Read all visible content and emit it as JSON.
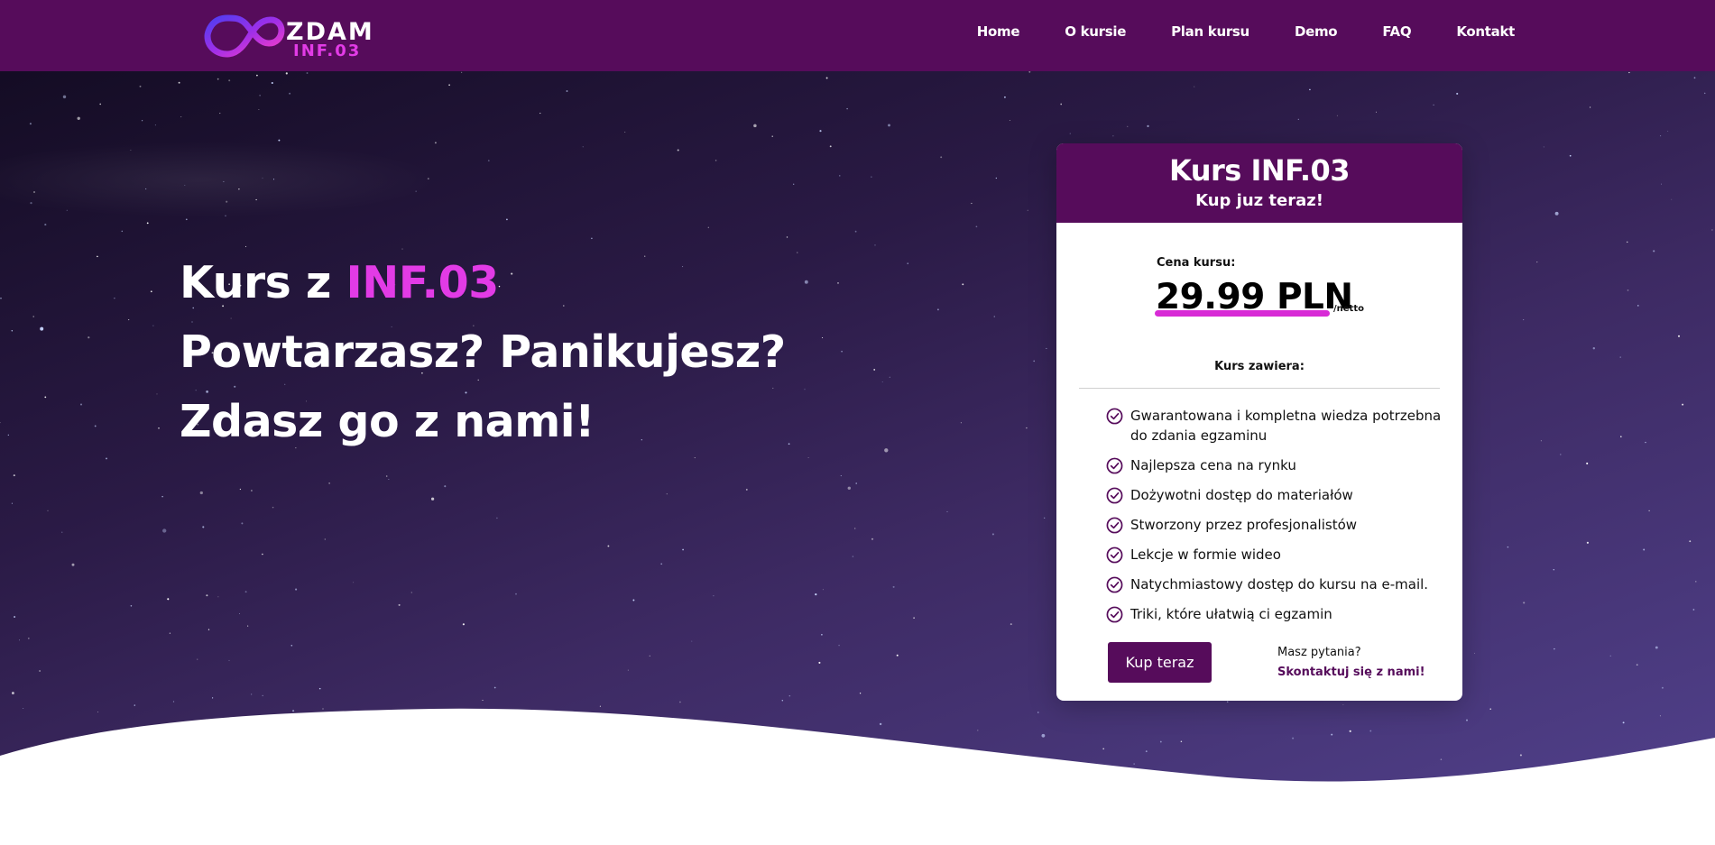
{
  "header": {
    "logo": {
      "word": "ZDAM",
      "sub": "INF.03"
    },
    "nav": [
      {
        "label": "Home"
      },
      {
        "label": "O kursie"
      },
      {
        "label": "Plan kursu"
      },
      {
        "label": "Demo"
      },
      {
        "label": "FAQ"
      },
      {
        "label": "Kontakt"
      }
    ]
  },
  "hero": {
    "line1_prefix": "Kurs z ",
    "line1_accent": "INF.03",
    "line2": "Powtarzasz? Panikujesz?",
    "line3": "Zdasz go z nami!"
  },
  "card": {
    "title": "Kurs INF.03",
    "subtitle": "Kup juz teraz!",
    "price_label": "Cena kursu:",
    "price": "29.99 PLN",
    "price_unit": "/netto",
    "includes_title": "Kurs zawiera:",
    "features": [
      "Gwarantowana i kompletna wiedza potrzebna do zdania egzaminu",
      "Najlepsza cena na rynku",
      "Dożywotni dostęp do materiałów",
      "Stworzony przez profesjonalistów",
      "Lekcje w formie wideo",
      "Natychmiastowy dostęp do kursu na e-mail.",
      "Triki, które ułatwią ci egzamin"
    ],
    "buy_button": "Kup teraz",
    "questions_text": "Masz pytania?",
    "contact_link": "Skontaktuj się z nami!"
  },
  "colors": {
    "brand": "#560c5b",
    "accent": "#e23be6",
    "underline": "#d82bd6"
  },
  "icons": [
    "infinity-logo-icon",
    "check-circle-icon"
  ]
}
